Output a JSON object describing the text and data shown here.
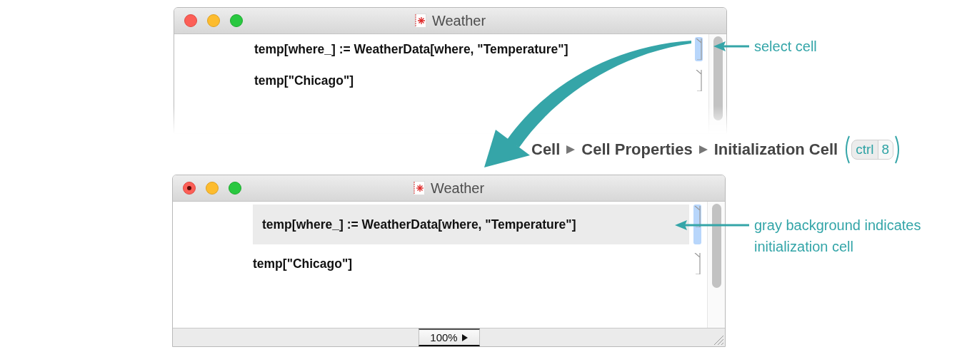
{
  "windows": [
    {
      "title": "Weather",
      "modified": false,
      "cells": [
        {
          "text": "temp[where_] := WeatherData[where, \"Temperature\"]",
          "selected": true,
          "initialization": false
        },
        {
          "text": "temp[\"Chicago\"]",
          "selected": false,
          "initialization": false
        }
      ]
    },
    {
      "title": "Weather",
      "modified": true,
      "cells": [
        {
          "text": "temp[where_] := WeatherData[where, \"Temperature\"]",
          "selected": true,
          "initialization": true
        },
        {
          "text": "temp[\"Chicago\"]",
          "selected": false,
          "initialization": false
        }
      ],
      "zoom": "100%"
    }
  ],
  "menu_path": [
    "Cell",
    "Cell Properties",
    "Initialization Cell"
  ],
  "shortcut": [
    "ctrl",
    "8"
  ],
  "annotations": [
    {
      "text": "select cell"
    },
    {
      "text": "gray background indicates initialization cell"
    }
  ]
}
